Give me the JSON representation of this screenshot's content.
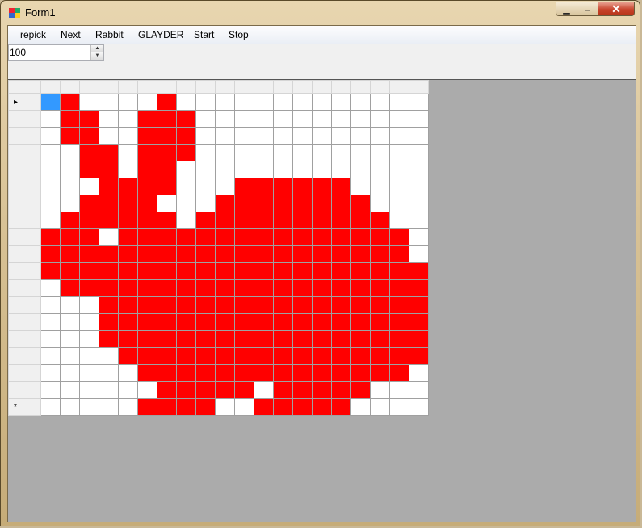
{
  "window": {
    "title": "Form1"
  },
  "menu": {
    "items": [
      {
        "label": "repick"
      },
      {
        "label": "Next"
      },
      {
        "label": "Rabbit"
      },
      {
        "label": "GLAYDER"
      },
      {
        "label": "Start"
      },
      {
        "label": "Stop"
      }
    ]
  },
  "spinner": {
    "value": "100"
  },
  "grid": {
    "current_row_marker": "▸",
    "new_row_marker": "*",
    "rows": [
      [
        2,
        1,
        0,
        0,
        0,
        0,
        1,
        0,
        0,
        0,
        0,
        0,
        0,
        0,
        0,
        0,
        0,
        0,
        0,
        0
      ],
      [
        0,
        1,
        1,
        0,
        0,
        1,
        1,
        1,
        0,
        0,
        0,
        0,
        0,
        0,
        0,
        0,
        0,
        0,
        0,
        0
      ],
      [
        0,
        1,
        1,
        0,
        0,
        1,
        1,
        1,
        0,
        0,
        0,
        0,
        0,
        0,
        0,
        0,
        0,
        0,
        0,
        0
      ],
      [
        0,
        0,
        1,
        1,
        0,
        1,
        1,
        1,
        0,
        0,
        0,
        0,
        0,
        0,
        0,
        0,
        0,
        0,
        0,
        0
      ],
      [
        0,
        0,
        1,
        1,
        0,
        1,
        1,
        0,
        0,
        0,
        0,
        0,
        0,
        0,
        0,
        0,
        0,
        0,
        0,
        0
      ],
      [
        0,
        0,
        0,
        1,
        1,
        1,
        1,
        0,
        0,
        0,
        1,
        1,
        1,
        1,
        1,
        1,
        0,
        0,
        0,
        0
      ],
      [
        0,
        0,
        1,
        1,
        1,
        1,
        0,
        0,
        0,
        1,
        1,
        1,
        1,
        1,
        1,
        1,
        1,
        0,
        0,
        0
      ],
      [
        0,
        1,
        1,
        1,
        1,
        1,
        1,
        0,
        1,
        1,
        1,
        1,
        1,
        1,
        1,
        1,
        1,
        1,
        0,
        0
      ],
      [
        1,
        1,
        1,
        0,
        1,
        1,
        1,
        1,
        1,
        1,
        1,
        1,
        1,
        1,
        1,
        1,
        1,
        1,
        1,
        0
      ],
      [
        1,
        1,
        1,
        1,
        1,
        1,
        1,
        1,
        1,
        1,
        1,
        1,
        1,
        1,
        1,
        1,
        1,
        1,
        1,
        0
      ],
      [
        1,
        1,
        1,
        1,
        1,
        1,
        1,
        1,
        1,
        1,
        1,
        1,
        1,
        1,
        1,
        1,
        1,
        1,
        1,
        1
      ],
      [
        0,
        1,
        1,
        1,
        1,
        1,
        1,
        1,
        1,
        1,
        1,
        1,
        1,
        1,
        1,
        1,
        1,
        1,
        1,
        1
      ],
      [
        0,
        0,
        0,
        1,
        1,
        1,
        1,
        1,
        1,
        1,
        1,
        1,
        1,
        1,
        1,
        1,
        1,
        1,
        1,
        1
      ],
      [
        0,
        0,
        0,
        1,
        1,
        1,
        1,
        1,
        1,
        1,
        1,
        1,
        1,
        1,
        1,
        1,
        1,
        1,
        1,
        1
      ],
      [
        0,
        0,
        0,
        1,
        1,
        1,
        1,
        1,
        1,
        1,
        1,
        1,
        1,
        1,
        1,
        1,
        1,
        1,
        1,
        1
      ],
      [
        0,
        0,
        0,
        0,
        1,
        1,
        1,
        1,
        1,
        1,
        1,
        1,
        1,
        1,
        1,
        1,
        1,
        1,
        1,
        1
      ],
      [
        0,
        0,
        0,
        0,
        0,
        1,
        1,
        1,
        1,
        1,
        1,
        1,
        1,
        1,
        1,
        1,
        1,
        1,
        1,
        0
      ],
      [
        0,
        0,
        0,
        0,
        0,
        0,
        1,
        1,
        1,
        1,
        1,
        0,
        1,
        1,
        1,
        1,
        1,
        0,
        0,
        0
      ],
      [
        0,
        0,
        0,
        0,
        0,
        1,
        1,
        1,
        1,
        0,
        0,
        1,
        1,
        1,
        1,
        1,
        0,
        0,
        0,
        0
      ]
    ]
  },
  "colors": {
    "alive": "#ff0000",
    "dead": "#ffffff",
    "selected": "#3399ff",
    "background": "#ababab"
  }
}
